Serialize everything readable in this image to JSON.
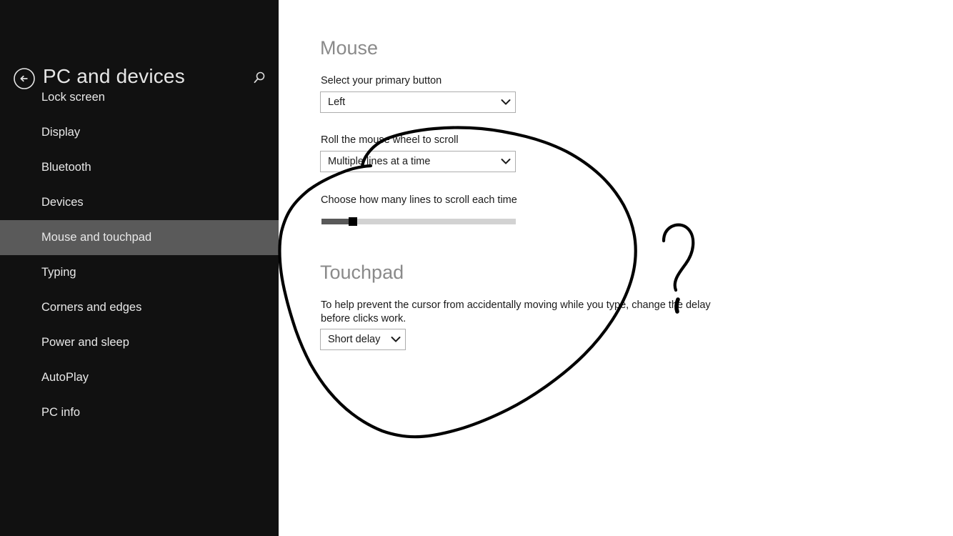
{
  "header": {
    "title": "PC and devices",
    "back_icon": "back-arrow-circle-icon",
    "search_icon": "search-icon"
  },
  "sidebar": {
    "background": "#111111",
    "selected_background": "#5a5a5a",
    "items": [
      {
        "label": "Lock screen",
        "selected": false
      },
      {
        "label": "Display",
        "selected": false
      },
      {
        "label": "Bluetooth",
        "selected": false
      },
      {
        "label": "Devices",
        "selected": false
      },
      {
        "label": "Mouse and touchpad",
        "selected": true
      },
      {
        "label": "Typing",
        "selected": false
      },
      {
        "label": "Corners and edges",
        "selected": false
      },
      {
        "label": "Power and sleep",
        "selected": false
      },
      {
        "label": "AutoPlay",
        "selected": false
      },
      {
        "label": "PC info",
        "selected": false
      }
    ]
  },
  "main": {
    "mouse": {
      "heading": "Mouse",
      "primary_button_label": "Select your primary button",
      "primary_button_value": "Left",
      "wheel_label": "Roll the mouse wheel to scroll",
      "wheel_value": "Multiple lines at a time",
      "lines_label": "Choose how many lines to scroll each time",
      "slider": {
        "value_percent": 14,
        "fill_color": "#595959",
        "track_color": "#d2d2d2",
        "thumb_color": "#000000"
      }
    },
    "touchpad": {
      "heading": "Touchpad",
      "description": "To help prevent the cursor from accidentally moving while you type, change the delay before clicks work.",
      "delay_value": "Short delay"
    }
  },
  "annotations": {
    "ink_color": "#000000",
    "shapes": [
      {
        "name": "circle-annotation",
        "kind": "freehand-ellipse"
      },
      {
        "name": "question-mark-annotation",
        "kind": "freehand-question-mark"
      }
    ]
  }
}
